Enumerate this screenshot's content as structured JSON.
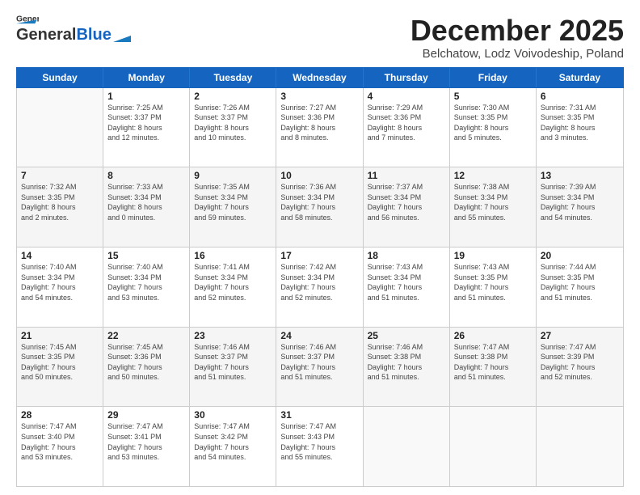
{
  "header": {
    "logo_general": "General",
    "logo_blue": "Blue",
    "title": "December 2025",
    "subtitle": "Belchatow, Lodz Voivodeship, Poland"
  },
  "days_of_week": [
    "Sunday",
    "Monday",
    "Tuesday",
    "Wednesday",
    "Thursday",
    "Friday",
    "Saturday"
  ],
  "weeks": [
    {
      "cells": [
        {
          "day": "",
          "empty": true
        },
        {
          "day": "1",
          "sunrise": "Sunrise: 7:25 AM",
          "sunset": "Sunset: 3:37 PM",
          "daylight": "Daylight: 8 hours",
          "minutes": "and 12 minutes."
        },
        {
          "day": "2",
          "sunrise": "Sunrise: 7:26 AM",
          "sunset": "Sunset: 3:37 PM",
          "daylight": "Daylight: 8 hours",
          "minutes": "and 10 minutes."
        },
        {
          "day": "3",
          "sunrise": "Sunrise: 7:27 AM",
          "sunset": "Sunset: 3:36 PM",
          "daylight": "Daylight: 8 hours",
          "minutes": "and 8 minutes."
        },
        {
          "day": "4",
          "sunrise": "Sunrise: 7:29 AM",
          "sunset": "Sunset: 3:36 PM",
          "daylight": "Daylight: 8 hours",
          "minutes": "and 7 minutes."
        },
        {
          "day": "5",
          "sunrise": "Sunrise: 7:30 AM",
          "sunset": "Sunset: 3:35 PM",
          "daylight": "Daylight: 8 hours",
          "minutes": "and 5 minutes."
        },
        {
          "day": "6",
          "sunrise": "Sunrise: 7:31 AM",
          "sunset": "Sunset: 3:35 PM",
          "daylight": "Daylight: 8 hours",
          "minutes": "and 3 minutes."
        }
      ]
    },
    {
      "shaded": true,
      "cells": [
        {
          "day": "7",
          "sunrise": "Sunrise: 7:32 AM",
          "sunset": "Sunset: 3:35 PM",
          "daylight": "Daylight: 8 hours",
          "minutes": "and 2 minutes."
        },
        {
          "day": "8",
          "sunrise": "Sunrise: 7:33 AM",
          "sunset": "Sunset: 3:34 PM",
          "daylight": "Daylight: 8 hours",
          "minutes": "and 0 minutes."
        },
        {
          "day": "9",
          "sunrise": "Sunrise: 7:35 AM",
          "sunset": "Sunset: 3:34 PM",
          "daylight": "Daylight: 7 hours",
          "minutes": "and 59 minutes."
        },
        {
          "day": "10",
          "sunrise": "Sunrise: 7:36 AM",
          "sunset": "Sunset: 3:34 PM",
          "daylight": "Daylight: 7 hours",
          "minutes": "and 58 minutes."
        },
        {
          "day": "11",
          "sunrise": "Sunrise: 7:37 AM",
          "sunset": "Sunset: 3:34 PM",
          "daylight": "Daylight: 7 hours",
          "minutes": "and 56 minutes."
        },
        {
          "day": "12",
          "sunrise": "Sunrise: 7:38 AM",
          "sunset": "Sunset: 3:34 PM",
          "daylight": "Daylight: 7 hours",
          "minutes": "and 55 minutes."
        },
        {
          "day": "13",
          "sunrise": "Sunrise: 7:39 AM",
          "sunset": "Sunset: 3:34 PM",
          "daylight": "Daylight: 7 hours",
          "minutes": "and 54 minutes."
        }
      ]
    },
    {
      "cells": [
        {
          "day": "14",
          "sunrise": "Sunrise: 7:40 AM",
          "sunset": "Sunset: 3:34 PM",
          "daylight": "Daylight: 7 hours",
          "minutes": "and 54 minutes."
        },
        {
          "day": "15",
          "sunrise": "Sunrise: 7:40 AM",
          "sunset": "Sunset: 3:34 PM",
          "daylight": "Daylight: 7 hours",
          "minutes": "and 53 minutes."
        },
        {
          "day": "16",
          "sunrise": "Sunrise: 7:41 AM",
          "sunset": "Sunset: 3:34 PM",
          "daylight": "Daylight: 7 hours",
          "minutes": "and 52 minutes."
        },
        {
          "day": "17",
          "sunrise": "Sunrise: 7:42 AM",
          "sunset": "Sunset: 3:34 PM",
          "daylight": "Daylight: 7 hours",
          "minutes": "and 52 minutes."
        },
        {
          "day": "18",
          "sunrise": "Sunrise: 7:43 AM",
          "sunset": "Sunset: 3:34 PM",
          "daylight": "Daylight: 7 hours",
          "minutes": "and 51 minutes."
        },
        {
          "day": "19",
          "sunrise": "Sunrise: 7:43 AM",
          "sunset": "Sunset: 3:35 PM",
          "daylight": "Daylight: 7 hours",
          "minutes": "and 51 minutes."
        },
        {
          "day": "20",
          "sunrise": "Sunrise: 7:44 AM",
          "sunset": "Sunset: 3:35 PM",
          "daylight": "Daylight: 7 hours",
          "minutes": "and 51 minutes."
        }
      ]
    },
    {
      "shaded": true,
      "cells": [
        {
          "day": "21",
          "sunrise": "Sunrise: 7:45 AM",
          "sunset": "Sunset: 3:35 PM",
          "daylight": "Daylight: 7 hours",
          "minutes": "and 50 minutes."
        },
        {
          "day": "22",
          "sunrise": "Sunrise: 7:45 AM",
          "sunset": "Sunset: 3:36 PM",
          "daylight": "Daylight: 7 hours",
          "minutes": "and 50 minutes."
        },
        {
          "day": "23",
          "sunrise": "Sunrise: 7:46 AM",
          "sunset": "Sunset: 3:37 PM",
          "daylight": "Daylight: 7 hours",
          "minutes": "and 51 minutes."
        },
        {
          "day": "24",
          "sunrise": "Sunrise: 7:46 AM",
          "sunset": "Sunset: 3:37 PM",
          "daylight": "Daylight: 7 hours",
          "minutes": "and 51 minutes."
        },
        {
          "day": "25",
          "sunrise": "Sunrise: 7:46 AM",
          "sunset": "Sunset: 3:38 PM",
          "daylight": "Daylight: 7 hours",
          "minutes": "and 51 minutes."
        },
        {
          "day": "26",
          "sunrise": "Sunrise: 7:47 AM",
          "sunset": "Sunset: 3:38 PM",
          "daylight": "Daylight: 7 hours",
          "minutes": "and 51 minutes."
        },
        {
          "day": "27",
          "sunrise": "Sunrise: 7:47 AM",
          "sunset": "Sunset: 3:39 PM",
          "daylight": "Daylight: 7 hours",
          "minutes": "and 52 minutes."
        }
      ]
    },
    {
      "cells": [
        {
          "day": "28",
          "sunrise": "Sunrise: 7:47 AM",
          "sunset": "Sunset: 3:40 PM",
          "daylight": "Daylight: 7 hours",
          "minutes": "and 53 minutes."
        },
        {
          "day": "29",
          "sunrise": "Sunrise: 7:47 AM",
          "sunset": "Sunset: 3:41 PM",
          "daylight": "Daylight: 7 hours",
          "minutes": "and 53 minutes."
        },
        {
          "day": "30",
          "sunrise": "Sunrise: 7:47 AM",
          "sunset": "Sunset: 3:42 PM",
          "daylight": "Daylight: 7 hours",
          "minutes": "and 54 minutes."
        },
        {
          "day": "31",
          "sunrise": "Sunrise: 7:47 AM",
          "sunset": "Sunset: 3:43 PM",
          "daylight": "Daylight: 7 hours",
          "minutes": "and 55 minutes."
        },
        {
          "day": "",
          "empty": true
        },
        {
          "day": "",
          "empty": true
        },
        {
          "day": "",
          "empty": true
        }
      ]
    }
  ]
}
